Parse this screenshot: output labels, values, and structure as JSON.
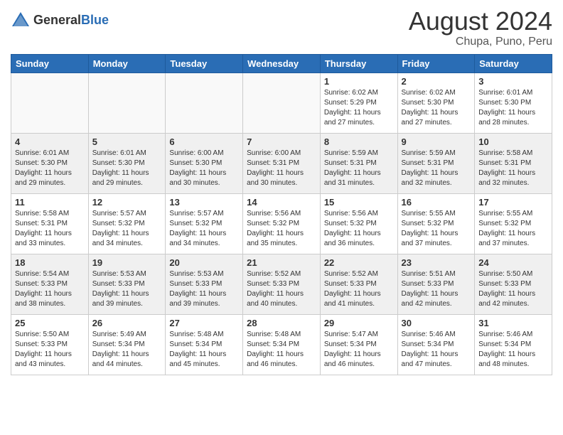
{
  "header": {
    "logo_general": "General",
    "logo_blue": "Blue",
    "month_year": "August 2024",
    "location": "Chupa, Puno, Peru"
  },
  "weekdays": [
    "Sunday",
    "Monday",
    "Tuesday",
    "Wednesday",
    "Thursday",
    "Friday",
    "Saturday"
  ],
  "weeks": [
    [
      {
        "day": "",
        "info": ""
      },
      {
        "day": "",
        "info": ""
      },
      {
        "day": "",
        "info": ""
      },
      {
        "day": "",
        "info": ""
      },
      {
        "day": "1",
        "info": "Sunrise: 6:02 AM\nSunset: 5:29 PM\nDaylight: 11 hours\nand 27 minutes."
      },
      {
        "day": "2",
        "info": "Sunrise: 6:02 AM\nSunset: 5:30 PM\nDaylight: 11 hours\nand 27 minutes."
      },
      {
        "day": "3",
        "info": "Sunrise: 6:01 AM\nSunset: 5:30 PM\nDaylight: 11 hours\nand 28 minutes."
      }
    ],
    [
      {
        "day": "4",
        "info": "Sunrise: 6:01 AM\nSunset: 5:30 PM\nDaylight: 11 hours\nand 29 minutes."
      },
      {
        "day": "5",
        "info": "Sunrise: 6:01 AM\nSunset: 5:30 PM\nDaylight: 11 hours\nand 29 minutes."
      },
      {
        "day": "6",
        "info": "Sunrise: 6:00 AM\nSunset: 5:30 PM\nDaylight: 11 hours\nand 30 minutes."
      },
      {
        "day": "7",
        "info": "Sunrise: 6:00 AM\nSunset: 5:31 PM\nDaylight: 11 hours\nand 30 minutes."
      },
      {
        "day": "8",
        "info": "Sunrise: 5:59 AM\nSunset: 5:31 PM\nDaylight: 11 hours\nand 31 minutes."
      },
      {
        "day": "9",
        "info": "Sunrise: 5:59 AM\nSunset: 5:31 PM\nDaylight: 11 hours\nand 32 minutes."
      },
      {
        "day": "10",
        "info": "Sunrise: 5:58 AM\nSunset: 5:31 PM\nDaylight: 11 hours\nand 32 minutes."
      }
    ],
    [
      {
        "day": "11",
        "info": "Sunrise: 5:58 AM\nSunset: 5:31 PM\nDaylight: 11 hours\nand 33 minutes."
      },
      {
        "day": "12",
        "info": "Sunrise: 5:57 AM\nSunset: 5:32 PM\nDaylight: 11 hours\nand 34 minutes."
      },
      {
        "day": "13",
        "info": "Sunrise: 5:57 AM\nSunset: 5:32 PM\nDaylight: 11 hours\nand 34 minutes."
      },
      {
        "day": "14",
        "info": "Sunrise: 5:56 AM\nSunset: 5:32 PM\nDaylight: 11 hours\nand 35 minutes."
      },
      {
        "day": "15",
        "info": "Sunrise: 5:56 AM\nSunset: 5:32 PM\nDaylight: 11 hours\nand 36 minutes."
      },
      {
        "day": "16",
        "info": "Sunrise: 5:55 AM\nSunset: 5:32 PM\nDaylight: 11 hours\nand 37 minutes."
      },
      {
        "day": "17",
        "info": "Sunrise: 5:55 AM\nSunset: 5:32 PM\nDaylight: 11 hours\nand 37 minutes."
      }
    ],
    [
      {
        "day": "18",
        "info": "Sunrise: 5:54 AM\nSunset: 5:33 PM\nDaylight: 11 hours\nand 38 minutes."
      },
      {
        "day": "19",
        "info": "Sunrise: 5:53 AM\nSunset: 5:33 PM\nDaylight: 11 hours\nand 39 minutes."
      },
      {
        "day": "20",
        "info": "Sunrise: 5:53 AM\nSunset: 5:33 PM\nDaylight: 11 hours\nand 39 minutes."
      },
      {
        "day": "21",
        "info": "Sunrise: 5:52 AM\nSunset: 5:33 PM\nDaylight: 11 hours\nand 40 minutes."
      },
      {
        "day": "22",
        "info": "Sunrise: 5:52 AM\nSunset: 5:33 PM\nDaylight: 11 hours\nand 41 minutes."
      },
      {
        "day": "23",
        "info": "Sunrise: 5:51 AM\nSunset: 5:33 PM\nDaylight: 11 hours\nand 42 minutes."
      },
      {
        "day": "24",
        "info": "Sunrise: 5:50 AM\nSunset: 5:33 PM\nDaylight: 11 hours\nand 42 minutes."
      }
    ],
    [
      {
        "day": "25",
        "info": "Sunrise: 5:50 AM\nSunset: 5:33 PM\nDaylight: 11 hours\nand 43 minutes."
      },
      {
        "day": "26",
        "info": "Sunrise: 5:49 AM\nSunset: 5:34 PM\nDaylight: 11 hours\nand 44 minutes."
      },
      {
        "day": "27",
        "info": "Sunrise: 5:48 AM\nSunset: 5:34 PM\nDaylight: 11 hours\nand 45 minutes."
      },
      {
        "day": "28",
        "info": "Sunrise: 5:48 AM\nSunset: 5:34 PM\nDaylight: 11 hours\nand 46 minutes."
      },
      {
        "day": "29",
        "info": "Sunrise: 5:47 AM\nSunset: 5:34 PM\nDaylight: 11 hours\nand 46 minutes."
      },
      {
        "day": "30",
        "info": "Sunrise: 5:46 AM\nSunset: 5:34 PM\nDaylight: 11 hours\nand 47 minutes."
      },
      {
        "day": "31",
        "info": "Sunrise: 5:46 AM\nSunset: 5:34 PM\nDaylight: 11 hours\nand 48 minutes."
      }
    ]
  ]
}
